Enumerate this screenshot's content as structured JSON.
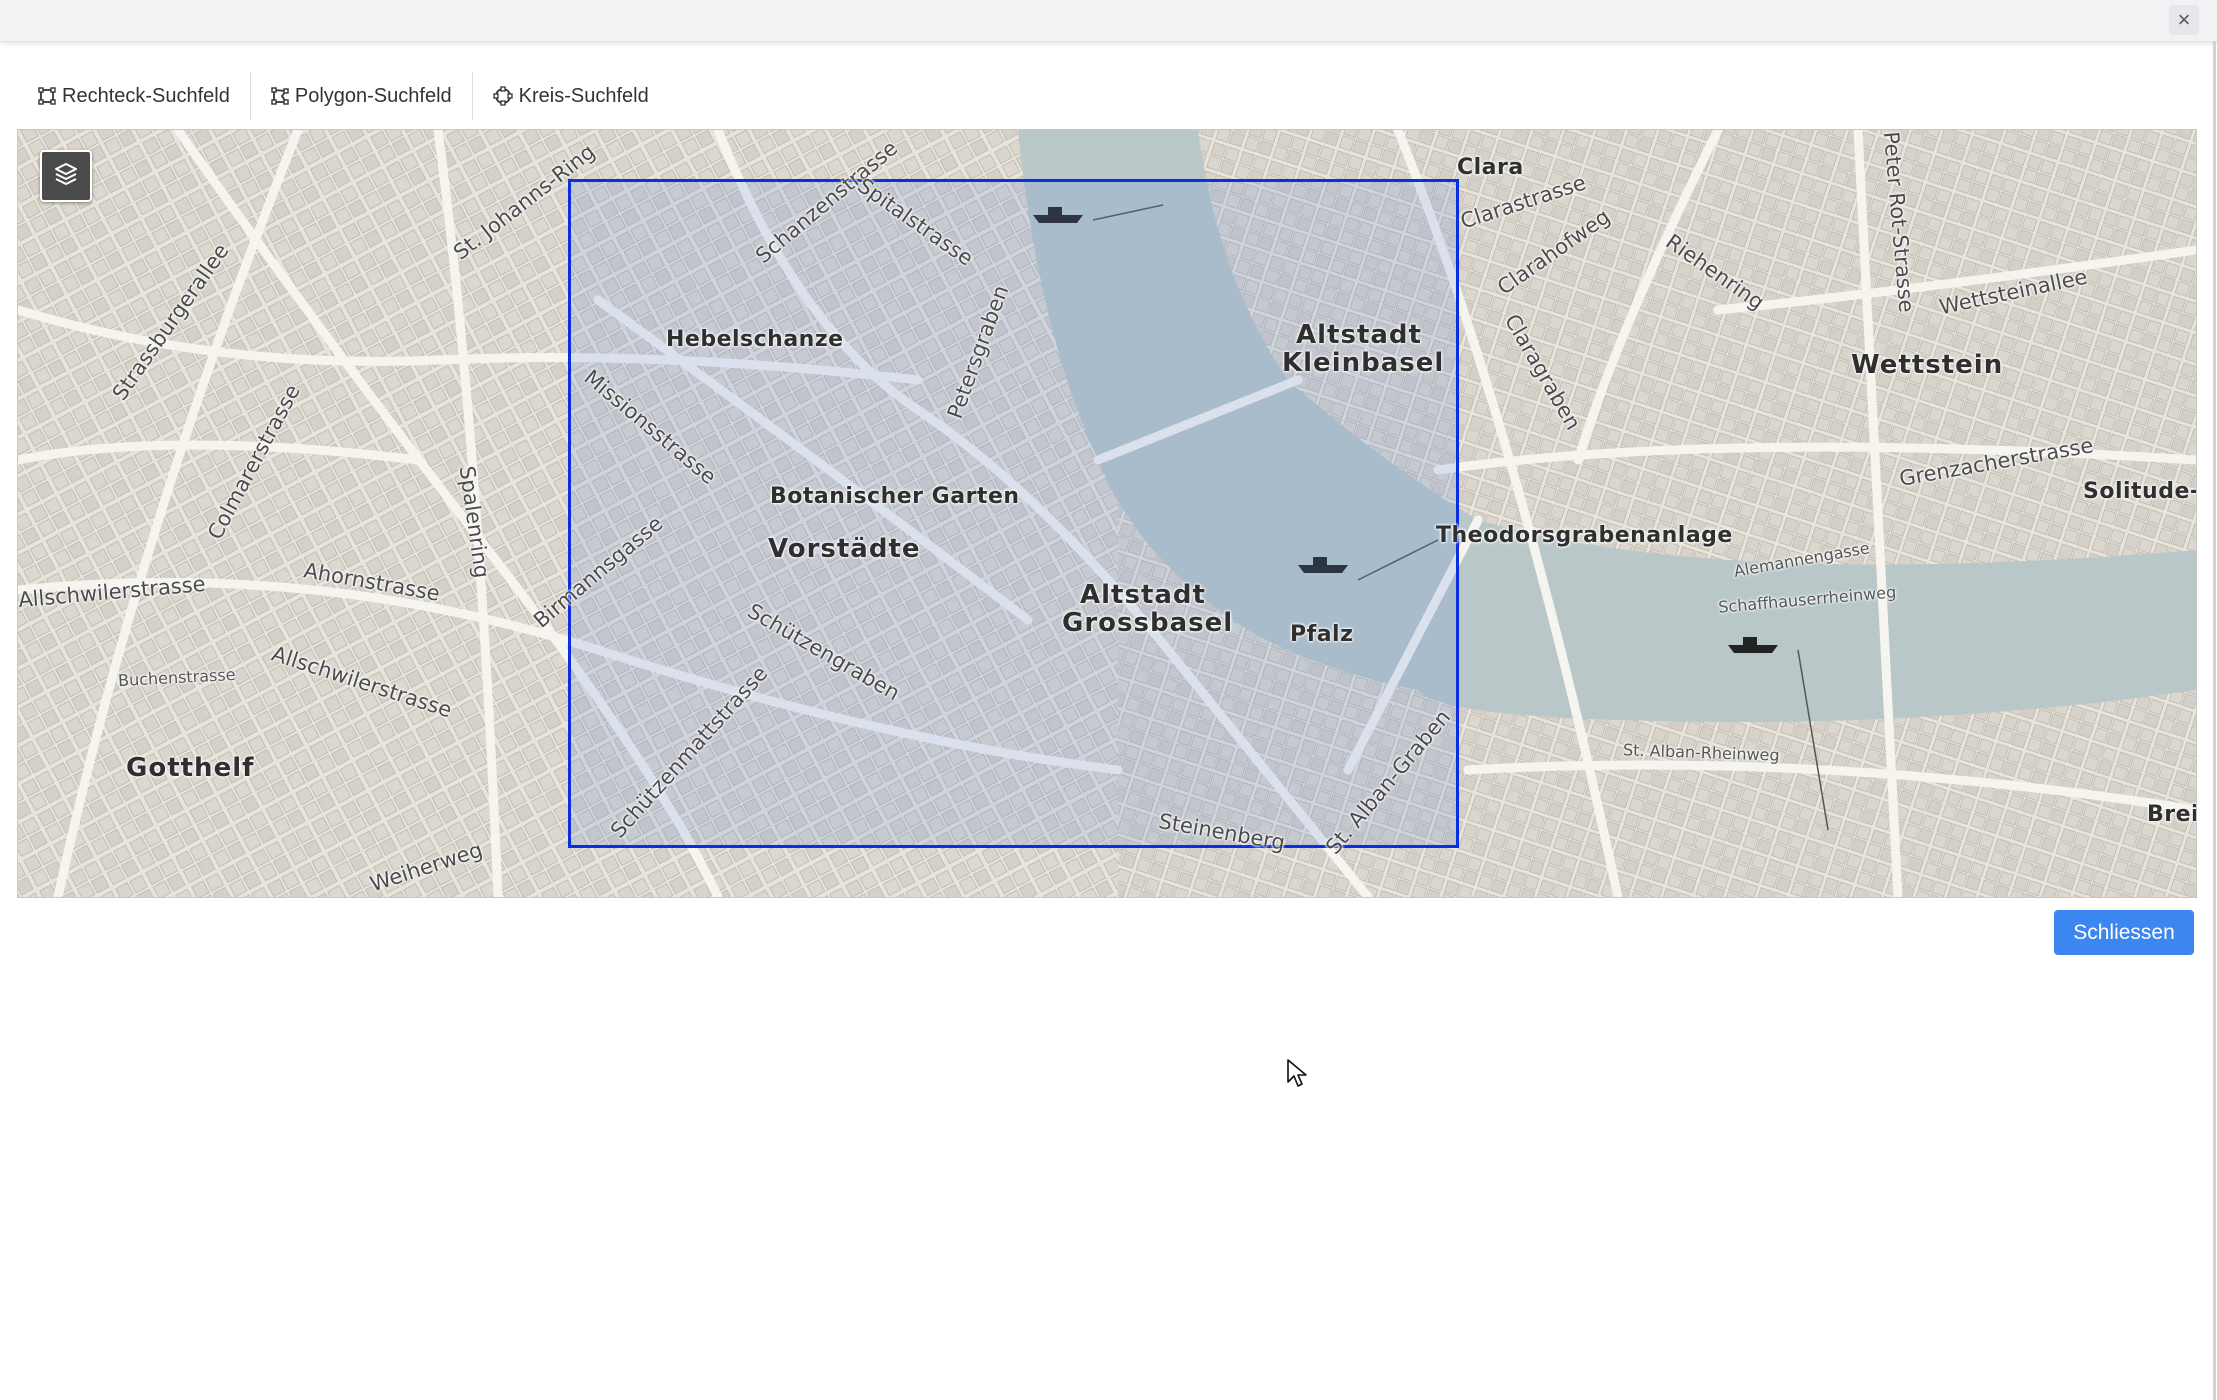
{
  "window": {
    "close_symbol": "×"
  },
  "toolbar": {
    "items": [
      {
        "label": "Rechteck-Suchfeld",
        "icon": "rectangle-draw-icon"
      },
      {
        "label": "Polygon-Suchfeld",
        "icon": "polygon-draw-icon"
      },
      {
        "label": "Kreis-Suchfeld",
        "icon": "circle-draw-icon"
      }
    ]
  },
  "map": {
    "layer_icon": "layers-icon",
    "search_rect_color": "#0a2ee0",
    "districts": {
      "clara": "Clara",
      "hebelschanze": "Hebelschanze",
      "altstadt_kleinbasel_1": "Altstadt",
      "altstadt_kleinbasel_2": "Kleinbasel",
      "wettstein": "Wettstein",
      "solitude": "Solitude-I",
      "botanischer_garten": "Botanischer Garten",
      "vorstaedte": "Vorstädte",
      "theodorsgrabenanlage": "Theodorsgrabenanlage",
      "altstadt_grossbasel_1": "Altstadt",
      "altstadt_grossbasel_2": "Grossbasel",
      "pfalz": "Pfalz",
      "gotthelf": "Gotthelf",
      "brei": "Brei"
    },
    "streets": {
      "strassburgerallee": "Strassburgerallee",
      "st_johanns_ring": "St. Johanns-Ring",
      "schanzenstrasse": "Schanzenstrasse",
      "spitalstrasse": "Spitalstrasse",
      "clarastrasse": "Clarastrasse",
      "clarahofweg": "Clarahofweg",
      "wettsteinallee": "Wettsteinallee",
      "rosentalstrasse": "Riehenring",
      "peter_rot": "Peter Rot-Strasse",
      "colmarerstrasse": "Colmarerstrasse",
      "missionsstrasse": "Missionsstrasse",
      "spalenring": "Spalenring",
      "petersgraben": "Petersgraben",
      "claragraben": "Claragraben",
      "grenzacherstrasse": "Grenzacherstrasse",
      "allschwilerstrasse": "Allschwilerstrasse",
      "ahornstrasse": "Ahornstrasse",
      "birmannsgasse": "Birmannsgasse",
      "schuetzengraben": "Schützengraben",
      "schuetzenmattstrasse": "Schützenmattstrasse",
      "steinenberg": "Steinenberg",
      "st_alban_graben": "St. Alban-Graben",
      "st_alban_rheinweg": "St. Alban-Rheinweg",
      "weiherweg": "Weiherweg",
      "alemannengasse": "Alemannengasse",
      "schaffhauserrheinweg": "Schaffhauserrheinweg",
      "buchenstrasse": "Buchenstrasse",
      "burgfelderstrasse": "Allschwilerstrasse"
    }
  },
  "footer": {
    "close_label": "Schliessen"
  }
}
